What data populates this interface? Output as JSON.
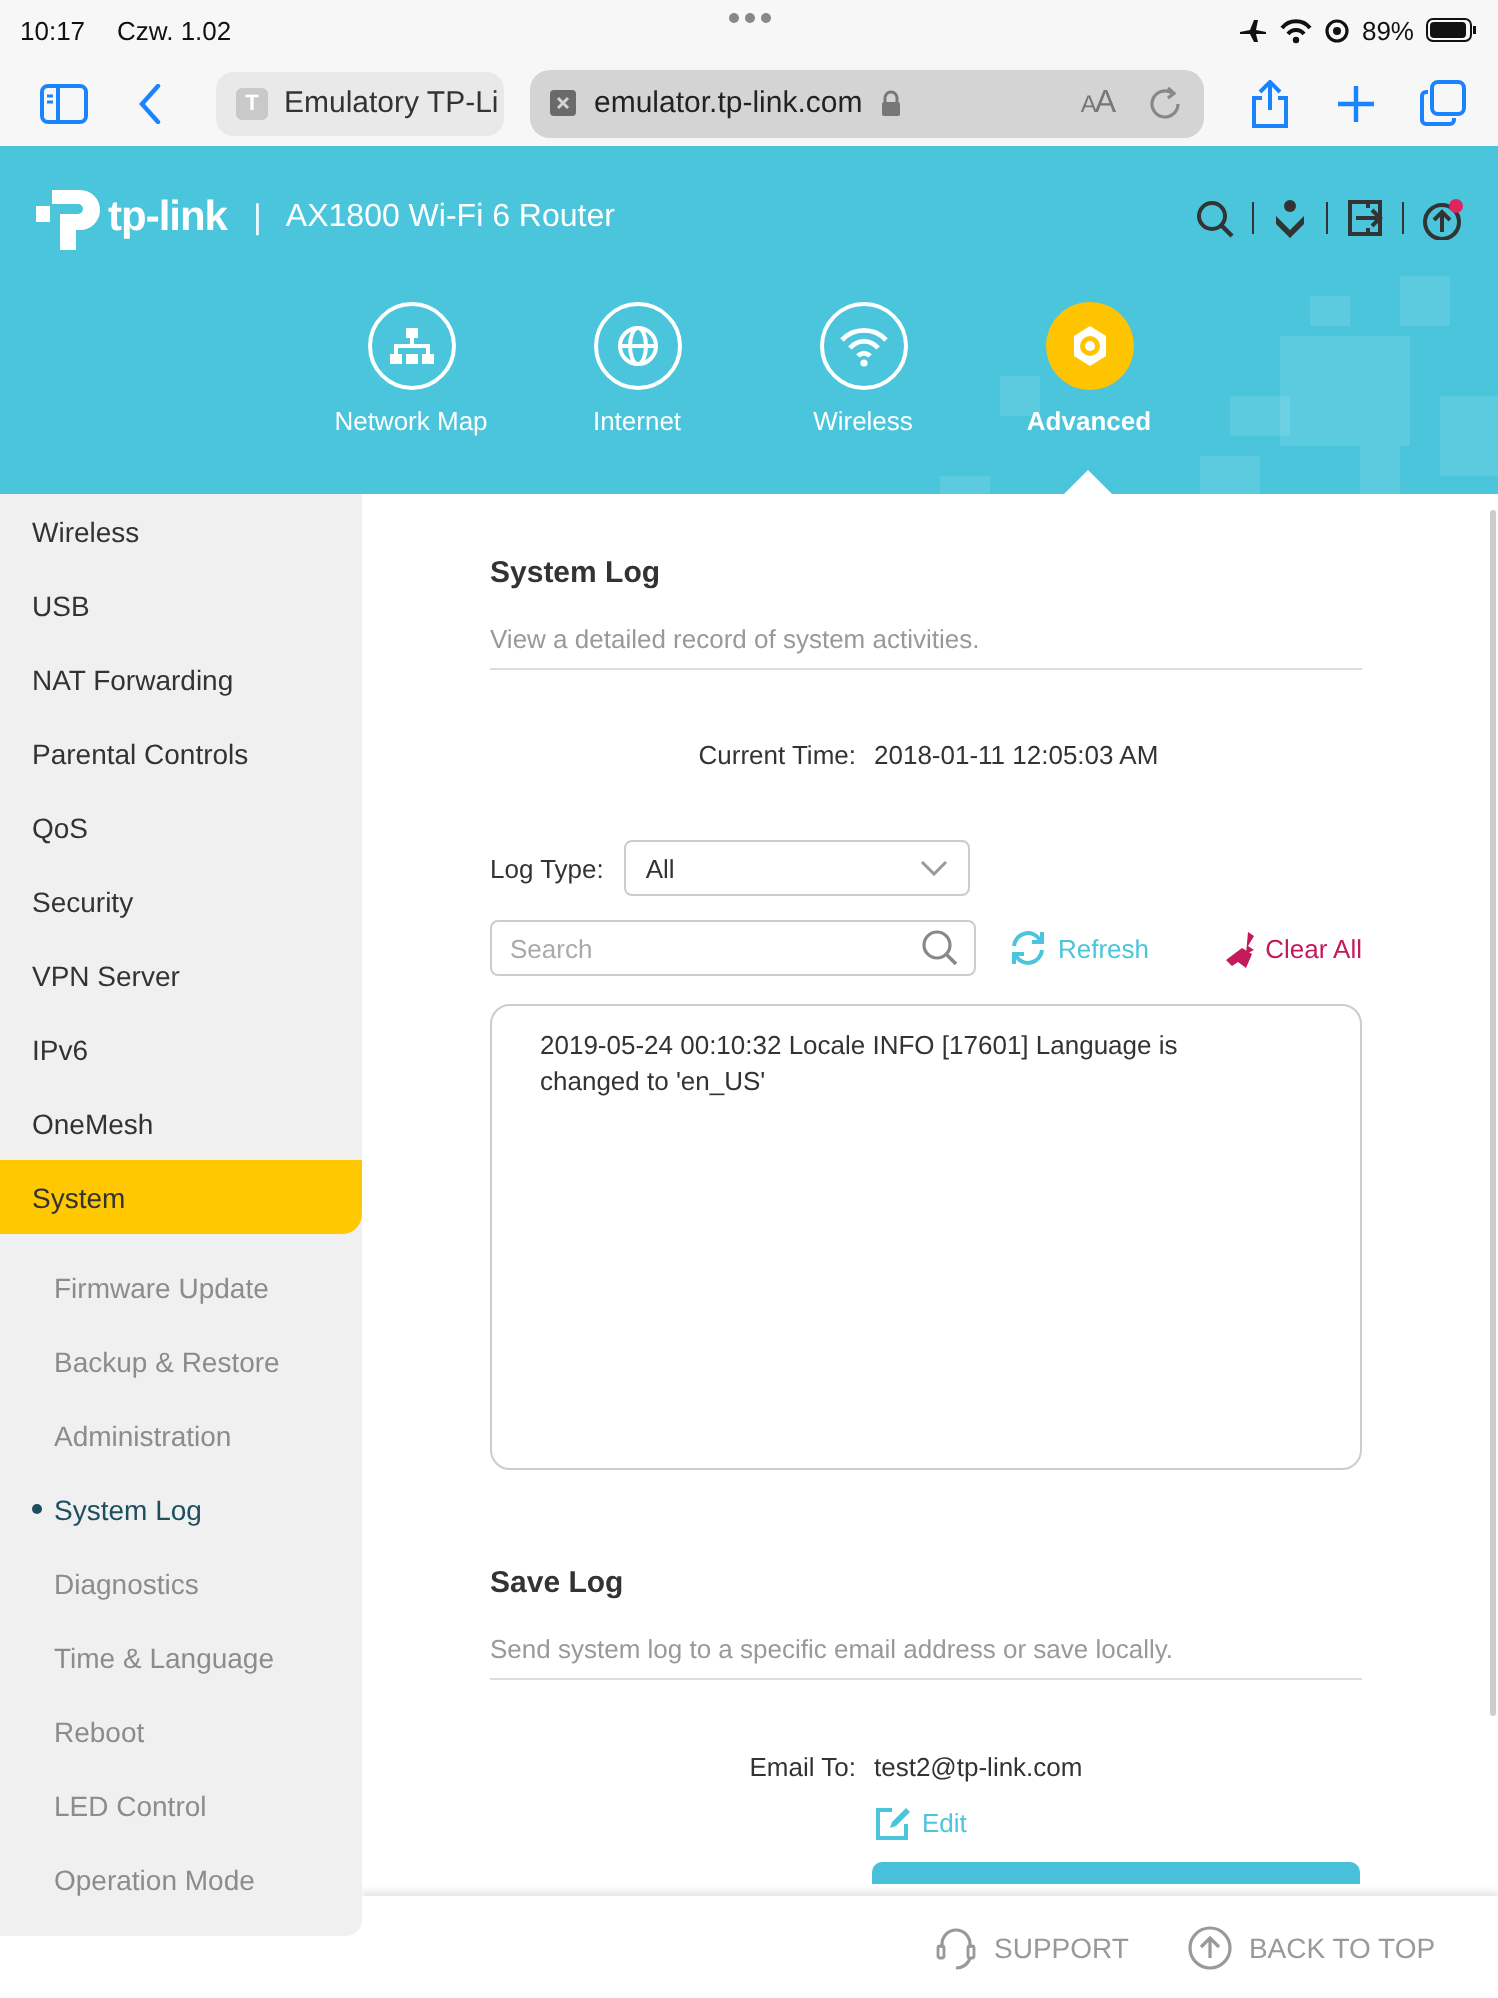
{
  "status_bar": {
    "time": "10:17",
    "date": "Czw. 1.02",
    "battery": "89%"
  },
  "browser": {
    "tab_icon": "T",
    "tab_title": "Emulatory TP-Li",
    "url": "emulator.tp-link.com",
    "text_size": "AA"
  },
  "header": {
    "brand": "tp-link",
    "separator": "|",
    "model": "AX1800 Wi-Fi 6 Router",
    "nav": [
      {
        "label": "Network Map",
        "kind": "network",
        "selected": false
      },
      {
        "label": "Internet",
        "kind": "globe",
        "selected": false
      },
      {
        "label": "Wireless",
        "kind": "wifi",
        "selected": false
      },
      {
        "label": "Advanced",
        "kind": "gear",
        "selected": true
      }
    ]
  },
  "sidebar": {
    "items": [
      {
        "label": "Wireless",
        "selected": false
      },
      {
        "label": "USB",
        "selected": false
      },
      {
        "label": "NAT Forwarding",
        "selected": false
      },
      {
        "label": "Parental Controls",
        "selected": false
      },
      {
        "label": "QoS",
        "selected": false
      },
      {
        "label": "Security",
        "selected": false
      },
      {
        "label": "VPN Server",
        "selected": false
      },
      {
        "label": "IPv6",
        "selected": false
      },
      {
        "label": "OneMesh",
        "selected": false
      },
      {
        "label": "System",
        "selected": true,
        "children": [
          {
            "label": "Firmware Update",
            "selected": false
          },
          {
            "label": "Backup & Restore",
            "selected": false
          },
          {
            "label": "Administration",
            "selected": false
          },
          {
            "label": "System Log",
            "selected": true
          },
          {
            "label": "Diagnostics",
            "selected": false
          },
          {
            "label": "Time & Language",
            "selected": false
          },
          {
            "label": "Reboot",
            "selected": false
          },
          {
            "label": "LED Control",
            "selected": false
          },
          {
            "label": "Operation Mode",
            "selected": false
          }
        ]
      }
    ]
  },
  "system_log": {
    "title": "System Log",
    "description": "View a detailed record of system activities.",
    "current_time_label": "Current Time:",
    "current_time": "2018-01-11 12:05:03 AM",
    "log_type_label": "Log Type:",
    "log_type": "All",
    "search_placeholder": "Search",
    "refresh": "Refresh",
    "clear_all": "Clear All",
    "entries": [
      "2019-05-24 00:10:32 Locale INFO [17601] Language is changed to 'en_US'"
    ]
  },
  "save_log": {
    "title": "Save Log",
    "description": "Send system log to a specific email address or save locally.",
    "email_label": "Email To:",
    "email": "test2@tp-link.com",
    "edit": "Edit"
  },
  "footer": {
    "support": "SUPPORT",
    "back_to_top": "BACK TO TOP"
  }
}
